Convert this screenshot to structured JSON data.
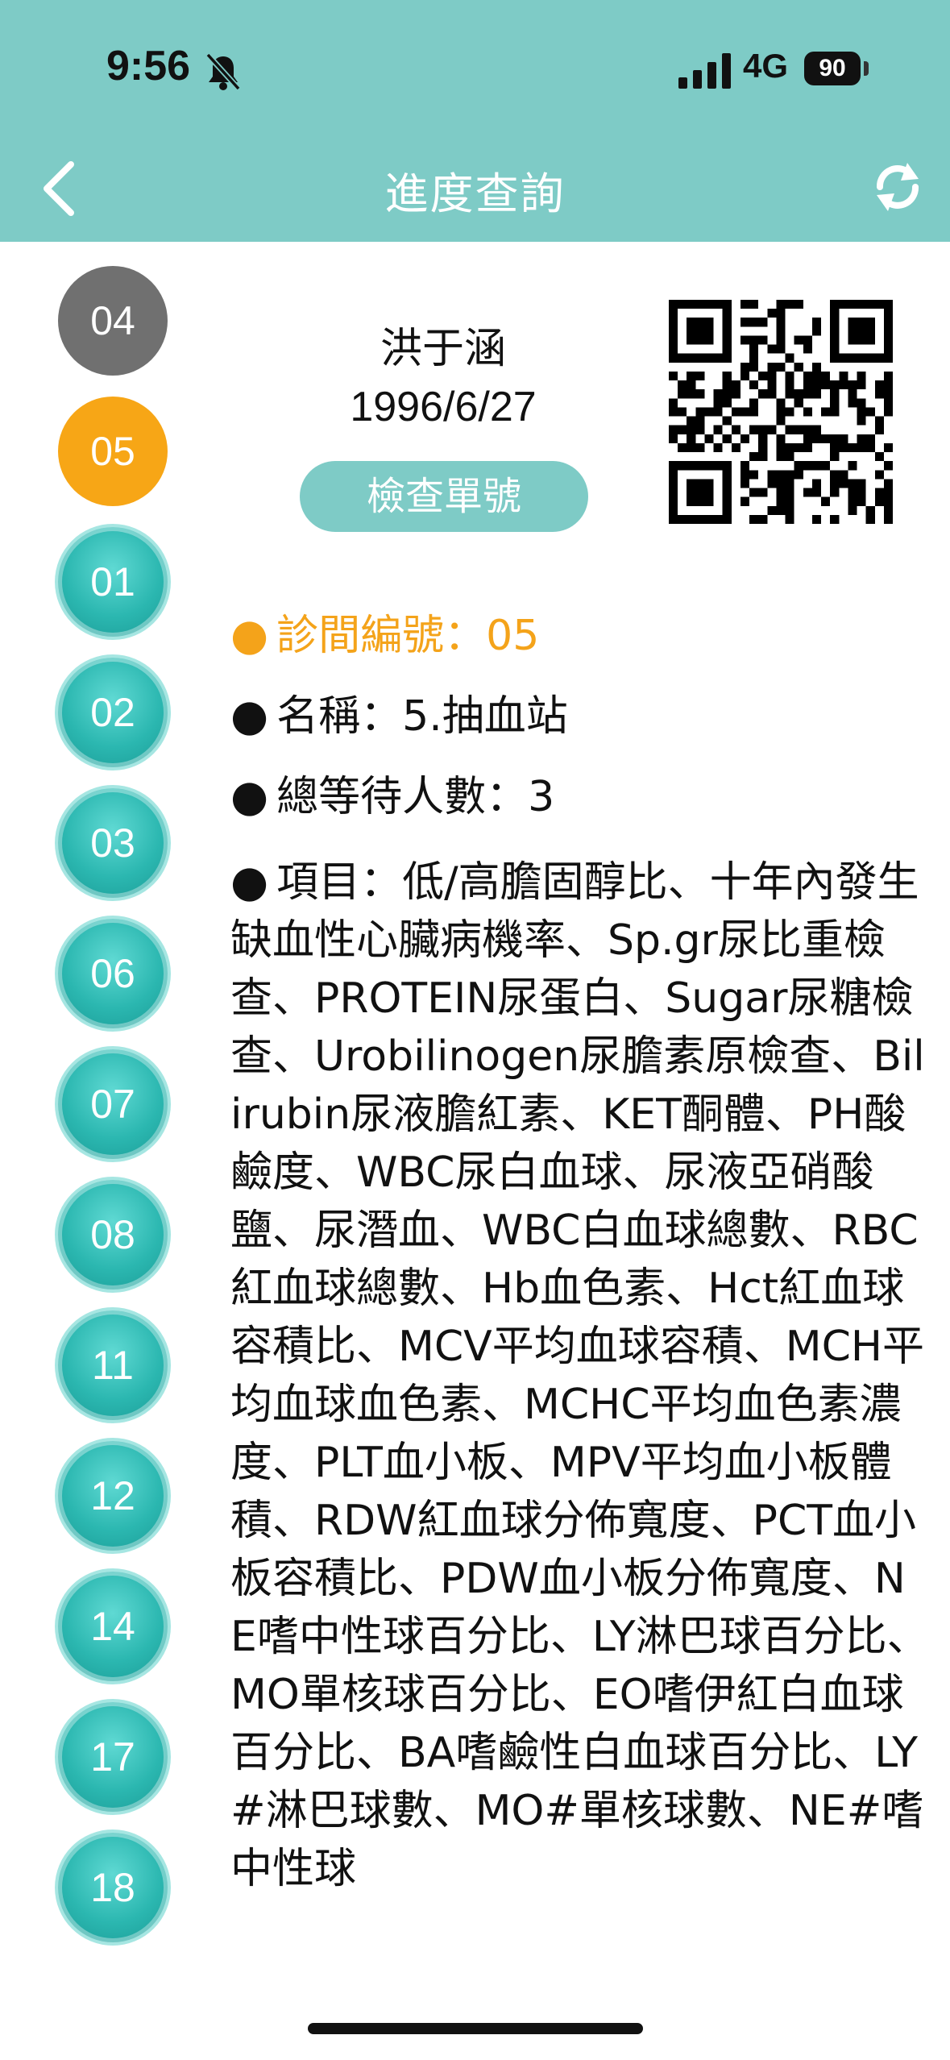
{
  "status_bar": {
    "time": "9:56",
    "network": "4G",
    "battery": "90"
  },
  "nav": {
    "title": "進度查詢"
  },
  "tabs": [
    {
      "label": "04",
      "state": "done"
    },
    {
      "label": "05",
      "state": "current"
    },
    {
      "label": "01",
      "state": "pending"
    },
    {
      "label": "02",
      "state": "pending"
    },
    {
      "label": "03",
      "state": "pending"
    },
    {
      "label": "06",
      "state": "pending"
    },
    {
      "label": "07",
      "state": "pending"
    },
    {
      "label": "08",
      "state": "pending"
    },
    {
      "label": "11",
      "state": "pending"
    },
    {
      "label": "12",
      "state": "pending"
    },
    {
      "label": "14",
      "state": "pending"
    },
    {
      "label": "17",
      "state": "pending"
    },
    {
      "label": "18",
      "state": "pending"
    }
  ],
  "patient": {
    "name": "洪于涵",
    "dob": "1996/6/27",
    "exam_button": "檢查單號"
  },
  "details": {
    "clinic_no": "診間編號：05",
    "name": "名稱：5.抽血站",
    "waiting": "總等待人數：3",
    "items": "項目：低/高膽固醇比、十年內發生缺血性心臟病機率、Sp.gr尿比重檢查、PROTEIN尿蛋白、Sugar尿糖檢查、Urobilinogen尿膽素原檢查、Bilirubin尿液膽紅素、KET酮體、PH酸鹼度、WBC尿白血球、尿液亞硝酸鹽、尿潛血、WBC白血球總數、RBC紅血球總數、Hb血色素、Hct紅血球容積比、MCV平均血球容積、MCH平均血球血色素、MCHC平均血色素濃度、PLT血小板、MPV平均血小板體積、RDW紅血球分佈寬度、PCT血小板容積比、PDW血小板分佈寬度、NE嗜中性球百分比、LY淋巴球百分比、MO單核球百分比、EO嗜伊紅白血球百分比、BA嗜鹼性白血球百分比、LY#淋巴球數、MO#單核球數、NE#嗜中性球"
  },
  "colors": {
    "header": "#7ecbc6",
    "accent_orange": "#f7a616",
    "tab_teal": "#2bb7b0",
    "tab_done": "#707070"
  },
  "icons": {
    "back": "chevron-left-icon",
    "refresh": "refresh-icon",
    "qr": "qr-code-icon",
    "bell": "bell-slash-icon"
  }
}
